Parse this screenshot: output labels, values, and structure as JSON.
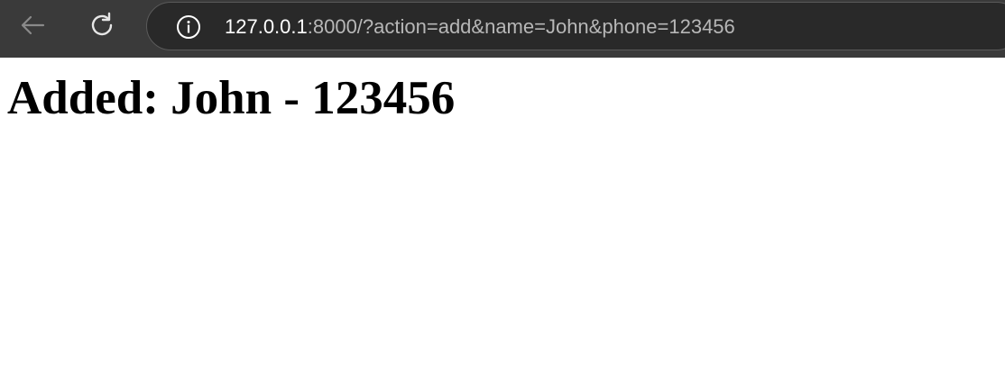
{
  "browser": {
    "url_host": "127.0.0.1",
    "url_rest": ":8000/?action=add&name=John&phone=123456",
    "icons": {
      "back": "back-arrow-icon",
      "reload": "reload-icon",
      "info": "info-icon"
    },
    "colors": {
      "chrome_bg": "#3a3a3a",
      "address_bg": "#292929",
      "url_host": "#ffffff",
      "url_rest": "#b7b7b7"
    }
  },
  "page": {
    "heading": "Added: John - 123456"
  }
}
